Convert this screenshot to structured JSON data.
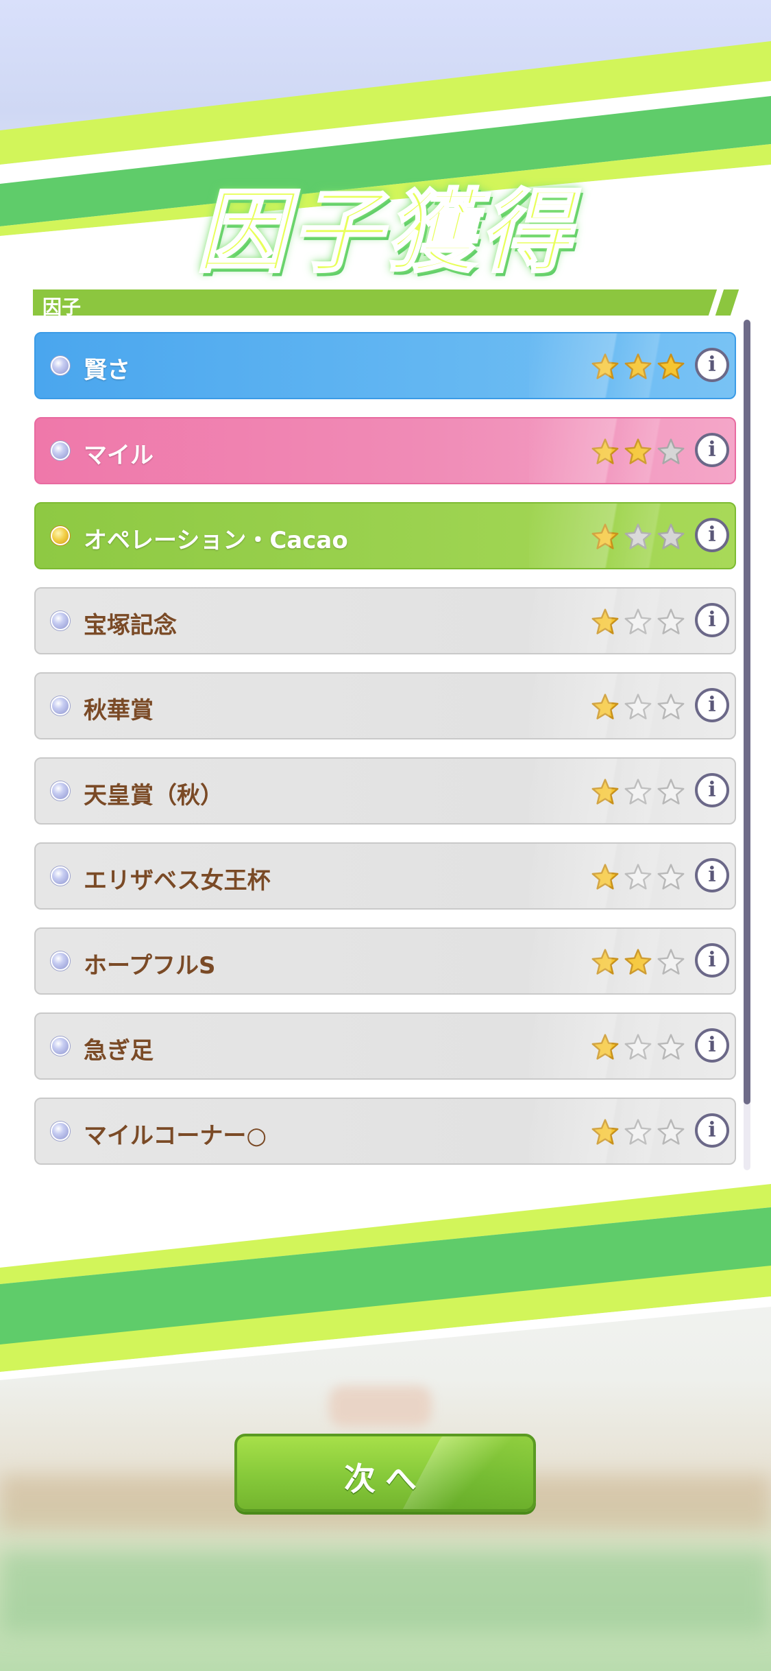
{
  "header": {
    "title": "因子獲得"
  },
  "section": {
    "label": "因子"
  },
  "factors": [
    {
      "name": "賢さ",
      "stars": 3,
      "style": "blue"
    },
    {
      "name": "マイル",
      "stars": 2,
      "style": "pink"
    },
    {
      "name": "オペレーション・Cacao",
      "stars": 1,
      "style": "green"
    },
    {
      "name": "宝塚記念",
      "stars": 1,
      "style": "gray"
    },
    {
      "name": "秋華賞",
      "stars": 1,
      "style": "gray"
    },
    {
      "name": "天皇賞（秋）",
      "stars": 1,
      "style": "gray"
    },
    {
      "name": "エリザベス女王杯",
      "stars": 1,
      "style": "gray"
    },
    {
      "name": "ホープフルS",
      "stars": 2,
      "style": "gray"
    },
    {
      "name": "急ぎ足",
      "stars": 1,
      "style": "gray"
    },
    {
      "name": "マイルコーナー○",
      "stars": 1,
      "style": "gray"
    }
  ],
  "info_glyph": "i",
  "footer": {
    "next_label": "次へ"
  },
  "colors": {
    "accent_green": "#8cc63f",
    "stripe_green": "#5fcc6a",
    "stripe_lime": "#d2f55a",
    "blue_row": "#4aa6ee",
    "pink_row": "#ef78aa",
    "green_row": "#8ec943",
    "gray_row": "#e4e4e4",
    "star_gold": "#f5c531",
    "race_text": "#7a4a26"
  }
}
